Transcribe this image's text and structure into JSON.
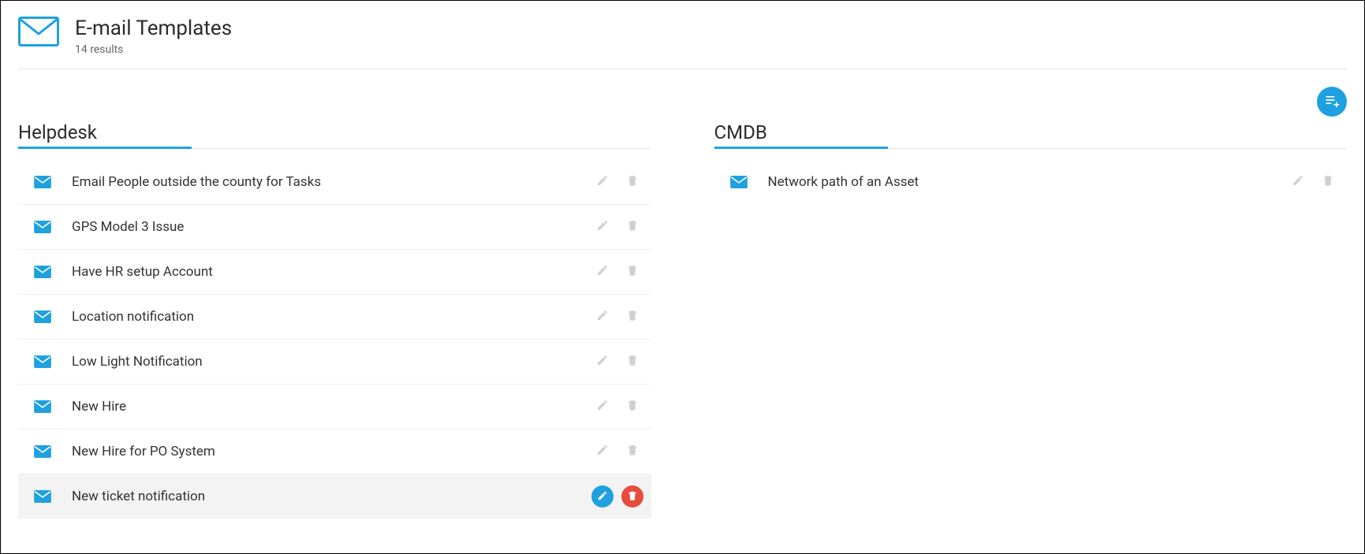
{
  "header": {
    "title": "E-mail Templates",
    "subtitle": "14 results"
  },
  "sections": {
    "helpdesk": {
      "title": "Helpdesk",
      "items": [
        {
          "label": "Email People outside the county for Tasks",
          "hovered": false
        },
        {
          "label": "GPS Model 3 Issue",
          "hovered": false
        },
        {
          "label": "Have HR setup Account",
          "hovered": false
        },
        {
          "label": "Location notification",
          "hovered": false
        },
        {
          "label": "Low Light Notification",
          "hovered": false
        },
        {
          "label": "New Hire",
          "hovered": false
        },
        {
          "label": "New Hire for PO System",
          "hovered": false
        },
        {
          "label": "New ticket notification",
          "hovered": true
        }
      ]
    },
    "cmdb": {
      "title": "CMDB",
      "items": [
        {
          "label": "Network path of an Asset",
          "hovered": false
        }
      ]
    }
  }
}
